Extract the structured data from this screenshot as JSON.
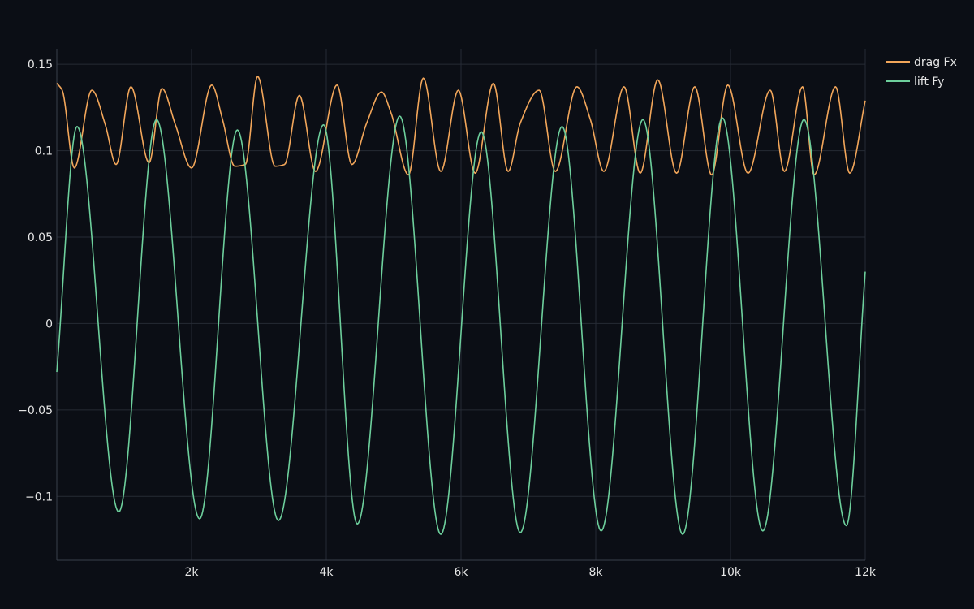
{
  "chart_data": {
    "type": "line",
    "title": "",
    "xlabel": "",
    "ylabel": "",
    "xlim": [
      0,
      12000
    ],
    "ylim": [
      -0.137,
      0.159
    ],
    "grid": true,
    "legend_position": "top-right",
    "x_ticks": [
      {
        "value": 2000,
        "label": "2k"
      },
      {
        "value": 4000,
        "label": "4k"
      },
      {
        "value": 6000,
        "label": "6k"
      },
      {
        "value": 8000,
        "label": "8k"
      },
      {
        "value": 10000,
        "label": "10k"
      },
      {
        "value": 12000,
        "label": "12k"
      }
    ],
    "y_ticks": [
      {
        "value": 0.15,
        "label": "0.15"
      },
      {
        "value": 0.1,
        "label": "0.1"
      },
      {
        "value": 0.05,
        "label": "0.05"
      },
      {
        "value": 0,
        "label": "0"
      },
      {
        "value": -0.05,
        "label": "−0.05"
      },
      {
        "value": -0.1,
        "label": "−0.1"
      }
    ],
    "series": [
      {
        "name": "drag Fx",
        "color": "#f2a65a",
        "x": [
          0,
          80,
          260,
          520,
          720,
          880,
          1100,
          1370,
          1560,
          1760,
          2000,
          2300,
          2460,
          2640,
          2800,
          2980,
          3240,
          3380,
          3600,
          3840,
          4160,
          4380,
          4600,
          4820,
          4960,
          5220,
          5440,
          5700,
          5960,
          6210,
          6480,
          6700,
          6880,
          7160,
          7400,
          7720,
          7920,
          8120,
          8420,
          8660,
          8920,
          9200,
          9470,
          9720,
          9960,
          10260,
          10590,
          10800,
          11070,
          11240,
          11560,
          11770,
          12000
        ],
        "values": [
          0.139,
          0.135,
          0.09,
          0.135,
          0.115,
          0.092,
          0.137,
          0.093,
          0.136,
          0.115,
          0.09,
          0.138,
          0.118,
          0.091,
          0.092,
          0.143,
          0.091,
          0.092,
          0.132,
          0.088,
          0.138,
          0.092,
          0.116,
          0.134,
          0.122,
          0.086,
          0.142,
          0.088,
          0.135,
          0.087,
          0.139,
          0.088,
          0.116,
          0.135,
          0.088,
          0.137,
          0.118,
          0.088,
          0.137,
          0.087,
          0.141,
          0.087,
          0.137,
          0.086,
          0.138,
          0.087,
          0.135,
          0.088,
          0.137,
          0.086,
          0.137,
          0.087,
          0.129
        ]
      },
      {
        "name": "lift Fy",
        "color": "#6dcf9c",
        "x": [
          0,
          300,
          920,
          1480,
          2120,
          2680,
          3290,
          3960,
          4460,
          5090,
          5700,
          6300,
          6880,
          7500,
          8080,
          8700,
          9290,
          9880,
          10480,
          11090,
          11720,
          12000
        ],
        "values": [
          -0.028,
          0.114,
          -0.109,
          0.118,
          -0.113,
          0.112,
          -0.114,
          0.115,
          -0.116,
          0.12,
          -0.122,
          0.111,
          -0.121,
          0.114,
          -0.12,
          0.118,
          -0.122,
          0.119,
          -0.12,
          0.118,
          -0.117,
          0.03
        ]
      }
    ]
  }
}
